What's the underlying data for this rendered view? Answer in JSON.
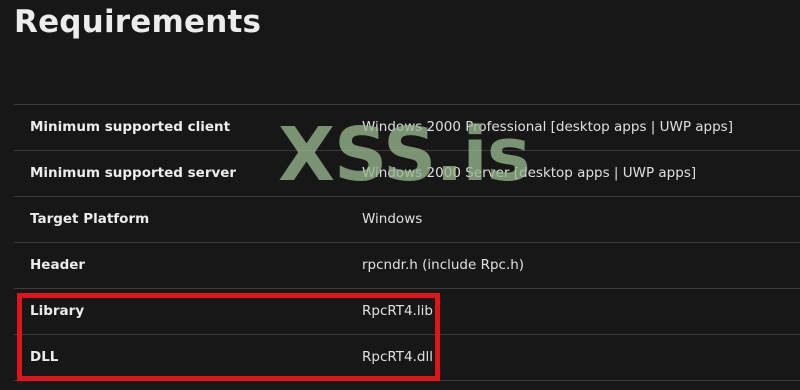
{
  "title": "Requirements",
  "requirements": [
    {
      "key": "Minimum supported client",
      "value": "Windows 2000 Professional [desktop apps | UWP apps]"
    },
    {
      "key": "Minimum supported server",
      "value": "Windows 2000 Server [desktop apps | UWP apps]"
    },
    {
      "key": "Target Platform",
      "value": "Windows"
    },
    {
      "key": "Header",
      "value": "rpcndr.h (include Rpc.h)"
    },
    {
      "key": "Library",
      "value": "RpcRT4.lib"
    },
    {
      "key": "DLL",
      "value": "RpcRT4.dll"
    }
  ],
  "watermark": "XSS.is",
  "colors": {
    "background": "#171717",
    "divider": "#3c3c3c",
    "highlight": "#e0141b",
    "watermark": "#96b68c"
  }
}
